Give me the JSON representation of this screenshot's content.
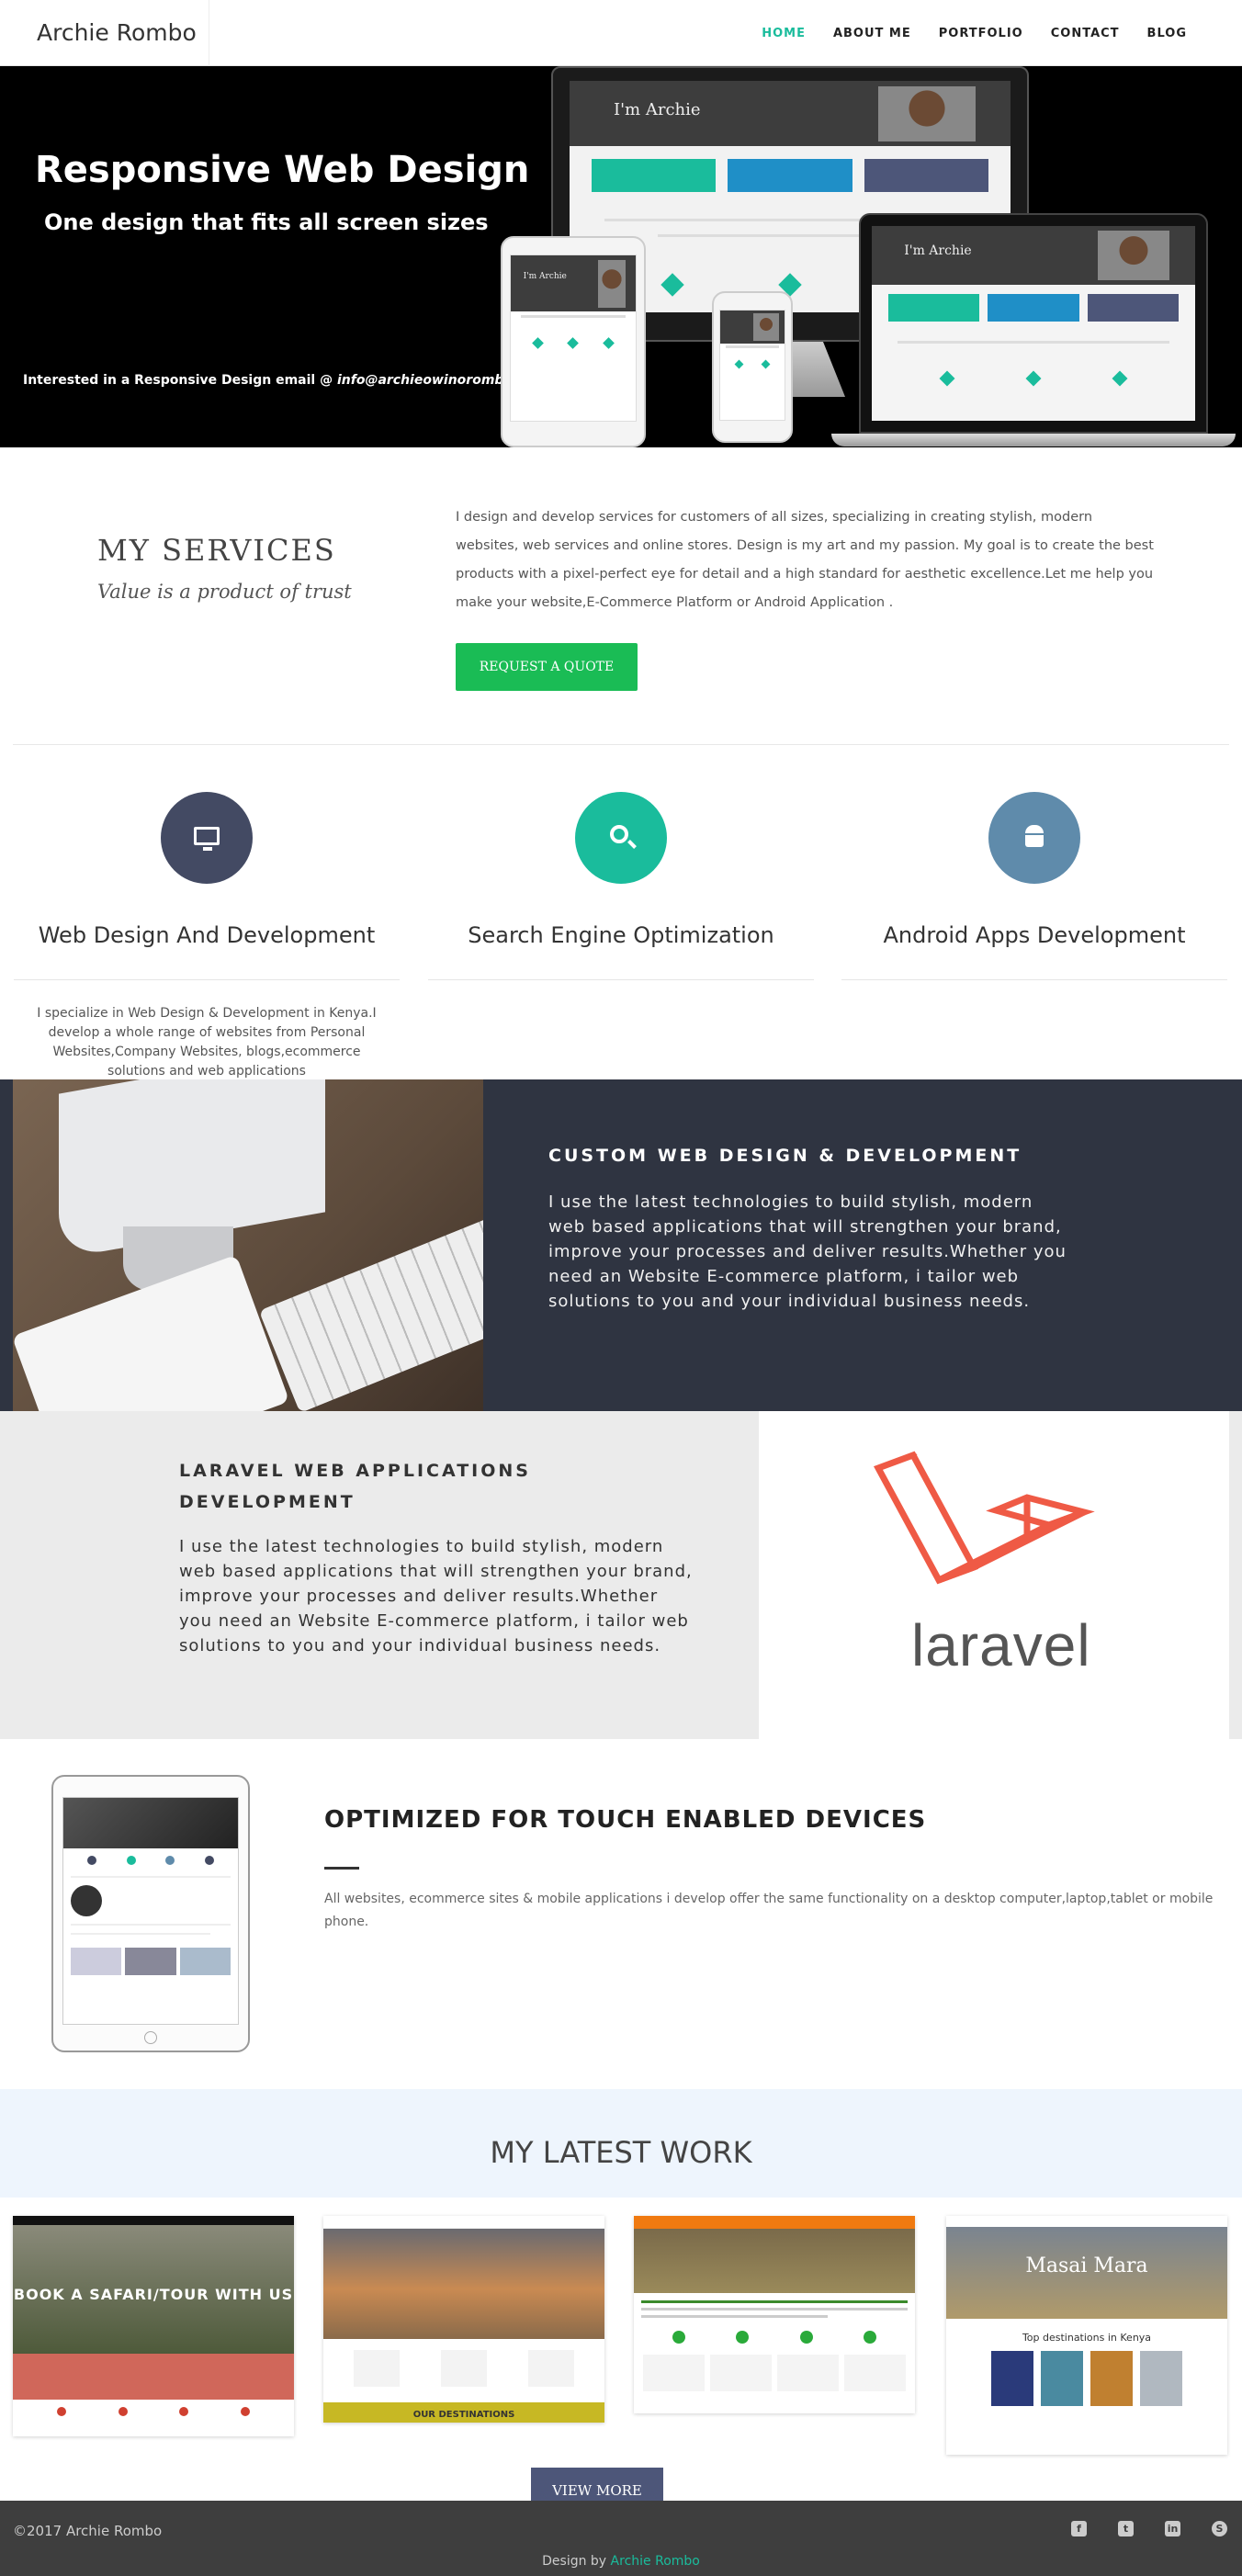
{
  "brand": "Archie Rombo",
  "nav": {
    "home": "HOME",
    "about": "ABOUT ME",
    "portfolio": "PORTFOLIO",
    "contact": "CONTACT",
    "blog": "BLOG"
  },
  "hero": {
    "title": "Responsive  Web Design",
    "subtitle": "One design that fits all screen sizes",
    "email_prefix": "Interested  in a Responsive Design email @ ",
    "email": "info@archieowinorombo.com",
    "mockup_name": "I'm Archie"
  },
  "services": {
    "title": "MY SERVICES",
    "subtitle": "Value is a product of trust",
    "text": "I design and develop services for customers of all sizes, specializing in creating stylish, modern websites, web services and online stores. Design is my art and my passion. My goal is to create the best products with a pixel-perfect eye for detail and a high standard for aesthetic excellence.Let me help you make your website,E-Commerce Platform or Android Application .",
    "button": "REQUEST A QUOTE"
  },
  "features": [
    {
      "title": "Web Design And Development",
      "text": "I specialize in Web Design & Development in Kenya.I develop a whole range of websites from Personal Websites,Company Websites, blogs,ecommerce solutions and web applications",
      "color": "#434a63"
    },
    {
      "title": "Search Engine Optimization",
      "text": "",
      "color": "#1abc9c"
    },
    {
      "title": "Android Apps Development",
      "text": "",
      "color": "#5f8bab"
    }
  ],
  "custom": {
    "title": "CUSTOM WEB DESIGN & DEVELOPMENT",
    "text": "I use the latest technologies to build stylish, modern web based applications that will strengthen your brand, improve your processes and deliver results.Whether you need an Website E-commerce platform, i tailor web solutions to you and your individual business needs."
  },
  "laravel": {
    "title": "LARAVEL WEB APPLICATIONS DEVELOPMENT",
    "text": "I use the latest technologies to build stylish, modern web based applications that will strengthen your brand, improve your processes and deliver results.Whether you need an Website E-commerce platform, i tailor web solutions to you and your individual business needs.",
    "logo_text": "laravel"
  },
  "optimized": {
    "title": "OPTIMIZED FOR TOUCH ENABLED DEVICES",
    "text": "All websites, ecommerce sites & mobile applications i develop offer the same functionality on a desktop computer,laptop,tablet or mobile phone."
  },
  "latest_work": {
    "title": "MY LATEST WORK",
    "items": [
      {
        "caption": "BOOK A SAFARI/TOUR WITH US"
      },
      {
        "caption": "OUR DESTINATIONS"
      },
      {
        "caption": ""
      },
      {
        "caption": "Masai Mara",
        "sub": "Top destinations in Kenya"
      }
    ],
    "button": "VIEW MORE"
  },
  "footer": {
    "copyright": "2017  Archie Rombo",
    "design_prefix": "Design by ",
    "design_name": "Archie Rombo",
    "social": [
      "facebook-icon",
      "twitter-icon",
      "linkedin-icon",
      "skype-icon"
    ]
  },
  "colors": {
    "accent": "#1abc9c",
    "quote_button": "#1abc55",
    "dark_band": "#2f3441",
    "laravel_red": "#ef5a45"
  }
}
